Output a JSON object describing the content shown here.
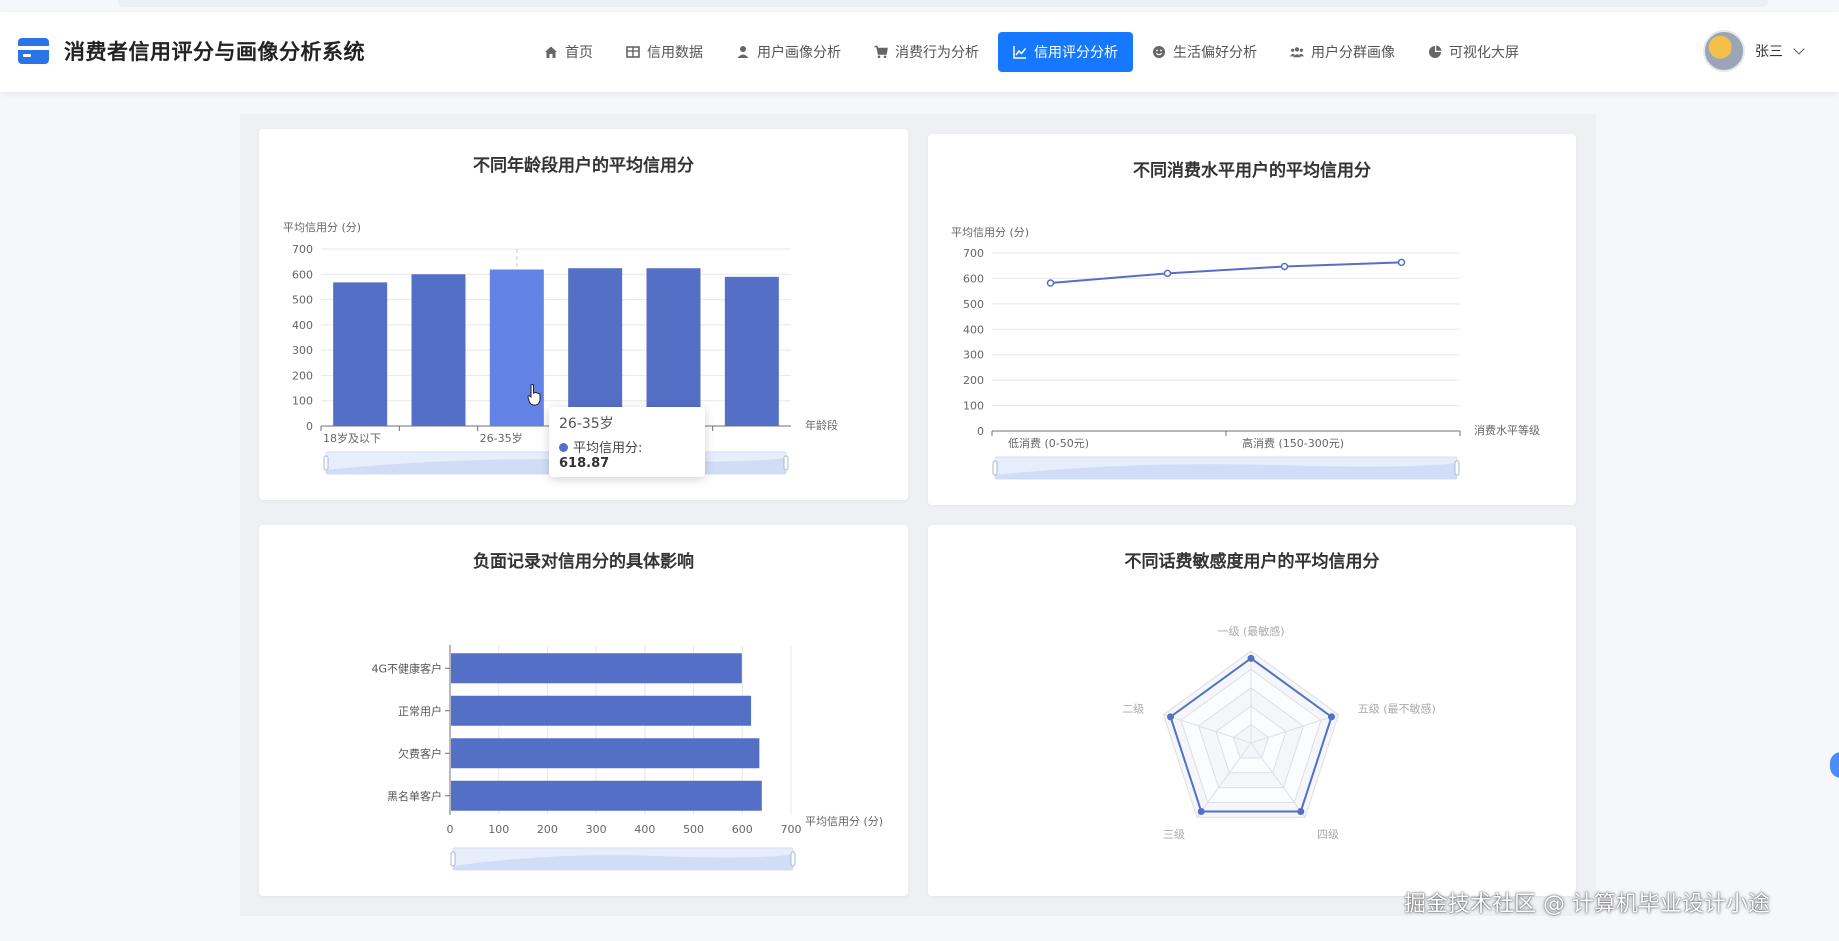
{
  "app": {
    "title": "消费者信用评分与画像分析系统"
  },
  "nav": {
    "items": [
      {
        "label": "首页",
        "icon": "home-icon"
      },
      {
        "label": "信用数据",
        "icon": "table-icon"
      },
      {
        "label": "用户画像分析",
        "icon": "user-icon"
      },
      {
        "label": "消费行为分析",
        "icon": "cart-icon"
      },
      {
        "label": "信用评分分析",
        "icon": "line-chart-icon",
        "active": true
      },
      {
        "label": "生活偏好分析",
        "icon": "smile-icon"
      },
      {
        "label": "用户分群画像",
        "icon": "team-icon"
      },
      {
        "label": "可视化大屏",
        "icon": "pie-chart-icon"
      }
    ]
  },
  "user": {
    "name": "张三"
  },
  "watermark": "掘金技术社区 @ 计算机毕业设计小途",
  "panels": {
    "age": {
      "title": "不同年龄段用户的平均信用分"
    },
    "consumption": {
      "title": "不同消费水平用户的平均信用分"
    },
    "negative": {
      "title": "负面记录对信用分的具体影响"
    },
    "sensitivity": {
      "title": "不同话费敏感度用户的平均信用分"
    }
  },
  "tooltip": {
    "title": "26-35岁",
    "series": "平均信用分",
    "value": "618.87"
  },
  "chart_data": [
    {
      "type": "bar",
      "title": "不同年龄段用户的平均信用分",
      "ylabel": "平均信用分 (分)",
      "xlabel": "年龄段",
      "ylim": [
        0,
        700
      ],
      "yticks": [
        0,
        100,
        200,
        300,
        400,
        500,
        600,
        700
      ],
      "category_labels": [
        "18岁及以下",
        "",
        "26-35岁",
        "",
        "",
        ""
      ],
      "values": [
        568,
        600,
        618.87,
        624,
        624,
        590
      ],
      "color": "#5470c6",
      "highlight_color": "#6283e5",
      "highlight_index": 2,
      "grid": true
    },
    {
      "type": "line",
      "title": "不同消费水平用户的平均信用分",
      "ylabel": "平均信用分 (分)",
      "xlabel": "消费水平等级",
      "ylim": [
        0,
        700
      ],
      "yticks": [
        0,
        100,
        200,
        300,
        400,
        500,
        600,
        700
      ],
      "category_labels": [
        "低消费 (0-50元)",
        "",
        "高消费 (150-300元)",
        ""
      ],
      "values": [
        582,
        620,
        647,
        663
      ],
      "color": "#5470c6",
      "grid": true
    },
    {
      "type": "bar",
      "orientation": "horizontal",
      "title": "负面记录对信用分的具体影响",
      "xlabel": "平均信用分 (分)",
      "xlim": [
        0,
        700
      ],
      "xticks": [
        0,
        100,
        200,
        300,
        400,
        500,
        600,
        700
      ],
      "categories": [
        "4G不健康客户",
        "正常用户",
        "欠费客户",
        "黑名单客户"
      ],
      "values": [
        597,
        616,
        633,
        638
      ],
      "color": "#5470c6",
      "grid": true
    },
    {
      "type": "radar",
      "title": "不同话费敏感度用户的平均信用分",
      "indicators": [
        "一级 (最敏感)",
        "五级 (最不敏感)",
        "四级",
        "三级",
        "二级"
      ],
      "values": [
        0.92,
        0.92,
        0.92,
        0.92,
        0.92
      ],
      "color": "#5470c6"
    }
  ]
}
